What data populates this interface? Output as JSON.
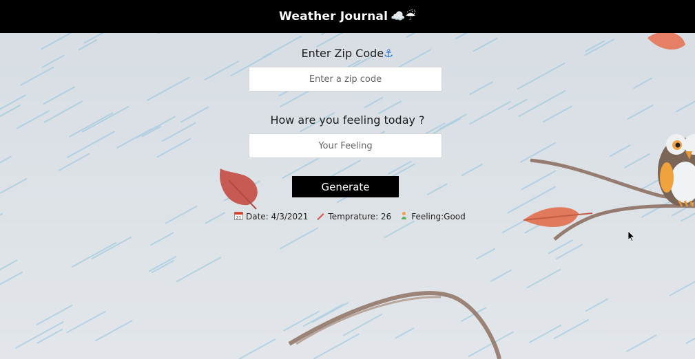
{
  "header": {
    "title": "Weather Journal",
    "emoji": "☁️☔"
  },
  "zip": {
    "label": "Enter Zip Code",
    "anchor": "⚓",
    "placeholder": "Enter a zip code"
  },
  "feeling": {
    "label": "How are you feeling today ?",
    "placeholder": "Your Feeling"
  },
  "generate": {
    "label": "Generate"
  },
  "results": {
    "date": "Date: 4/3/2021",
    "temp": "Temprature: 26",
    "feeling": "Feeling:Good"
  },
  "icons": {
    "calendar": "calendar-icon",
    "pencil": "pencil-icon",
    "person": "person-icon",
    "owl": "owl-illustration",
    "leaf": "leaf-illustration"
  }
}
